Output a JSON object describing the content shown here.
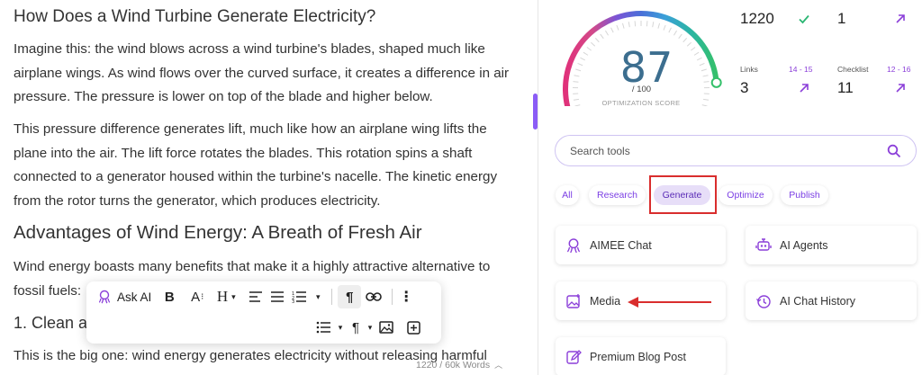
{
  "editor": {
    "heading1": "How Does a Wind Turbine Generate Electricity?",
    "para1": "Imagine this:  the wind blows across a wind turbine's blades, shaped much like airplane wings.  As wind flows over the curved surface, it creates a difference in air pressure.  The pressure is lower on top of the blade and higher below.",
    "para2": "This pressure difference generates lift, much like how an airplane wing lifts the plane into the air. The lift force rotates the blades. This rotation spins a shaft connected to a generator housed within the turbine's nacelle. The kinetic energy from the rotor turns the generator, which produces electricity.",
    "heading2": "Advantages of Wind Energy: A Breath of Fresh Air",
    "para3": "Wind energy boasts many benefits that make it a highly attractive alternative to fossil fuels:",
    "heading3_partial": "1. Clean a",
    "para4_partial": "This is the big one: wind energy generates electricity without releasing harmful",
    "word_count": "1220 / 60k Words"
  },
  "toolbar": {
    "ask_ai_label": "Ask AI",
    "bold": "B",
    "font_size": "A",
    "heading": "H",
    "paragraph": "¶"
  },
  "score": {
    "value": "87",
    "denominator": "/ 100",
    "label": "OPTIMIZATION SCORE",
    "fraction": 0.87
  },
  "metrics": {
    "words_value": "1220",
    "headings_value": "1",
    "links_label": "Links",
    "links_range": "14 - 15",
    "links_value": "3",
    "checklist_label": "Checklist",
    "checklist_range": "12 - 16",
    "checklist_value": "11"
  },
  "search": {
    "placeholder": "Search tools"
  },
  "filters": [
    "All",
    "Research",
    "Generate",
    "Optimize",
    "Publish"
  ],
  "active_filter": "Generate",
  "tools": {
    "aimee_chat": "AIMEE Chat",
    "ai_agents": "AI Agents",
    "media": "Media",
    "ai_chat_history": "AI Chat History",
    "premium_blog_post": "Premium Blog Post"
  },
  "colors": {
    "accent": "#8b3fd9",
    "highlight": "#d92d2d",
    "score_text": "#3c6e8f",
    "check_green": "#2bb673"
  }
}
